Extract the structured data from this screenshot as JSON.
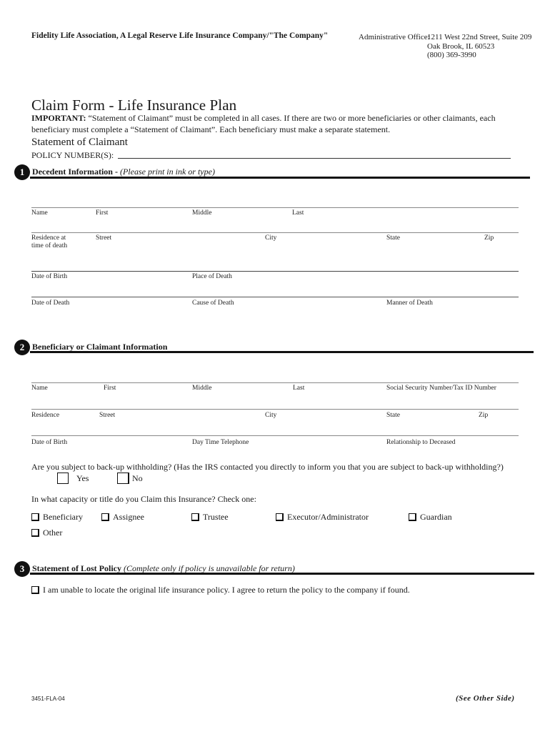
{
  "header": {
    "company": "Fidelity Life Association, A Legal Reserve Life Insurance Company/\"The Company\"",
    "admin_label": "Administrative Office:",
    "admin_address": [
      "1211 West 22nd Street, Suite 209",
      "Oak Brook, IL 60523",
      "(800) 369-3990"
    ]
  },
  "form": {
    "title": "Claim Form - Life Insurance Plan",
    "important_label": "IMPORTANT:",
    "important_text": " “Statement of Claimant” must be completed in all cases. If there are two or more beneficiaries or other claimants, each beneficiary must complete a “Statement of Claimant”. Each beneficiary must make a separate statement.",
    "subheading": "Statement of Claimant",
    "policy_label": "POLICY NUMBER(S):",
    "policy_value": ""
  },
  "section1": {
    "number": "1",
    "title": "Decedent Information - ",
    "note": "(Please print in ink or type)",
    "rows": [
      {
        "labels": [
          "Name",
          "First",
          "Middle",
          "Last"
        ]
      },
      {
        "labels": [
          "Residence at\ntime of death",
          "Street",
          "City",
          "State",
          "Zip"
        ]
      },
      {
        "labels": [
          "Date of Birth",
          "Place of Death"
        ]
      },
      {
        "labels": [
          "Date of Death",
          "Cause of Death",
          "Manner of Death"
        ]
      }
    ]
  },
  "section2": {
    "number": "2",
    "title": "Beneficiary or Claimant Information",
    "rows": [
      {
        "labels": [
          "Name",
          "First",
          "Middle",
          "Last",
          "Social Security Number/Tax ID Number"
        ]
      },
      {
        "labels": [
          "Residence",
          "Street",
          "City",
          "State",
          "Zip"
        ]
      },
      {
        "labels": [
          "Date of Birth",
          "Day Time Telephone",
          "Relationship to Deceased"
        ]
      }
    ],
    "withholding_question": "Are you subject to back-up withholding? (Has the IRS contacted you directly to inform you that you are subject to back-up withholding?)",
    "withholding_options": [
      {
        "label": "Yes",
        "checked": false
      },
      {
        "label": "No",
        "checked": false
      }
    ],
    "capacity_question": "In what capacity or title do you Claim this Insurance? Check one:",
    "capacity_options": [
      {
        "label": "Beneficiary",
        "checked": false
      },
      {
        "label": "Assignee",
        "checked": false
      },
      {
        "label": "Trustee",
        "checked": false
      },
      {
        "label": "Executor/Administrator",
        "checked": false
      },
      {
        "label": "Guardian",
        "checked": false
      },
      {
        "label": "Other",
        "checked": false
      }
    ]
  },
  "section3": {
    "number": "3",
    "title": "Statement of Lost Policy ",
    "note": "(Complete only if policy is unavailable for return)",
    "statement": "I am unable to locate the original life insurance policy. I agree to return the policy to the company if found.",
    "statement_checked": false
  },
  "footer": {
    "form_code": "3451-FLA-04",
    "see_other_side": "(See Other Side)"
  }
}
